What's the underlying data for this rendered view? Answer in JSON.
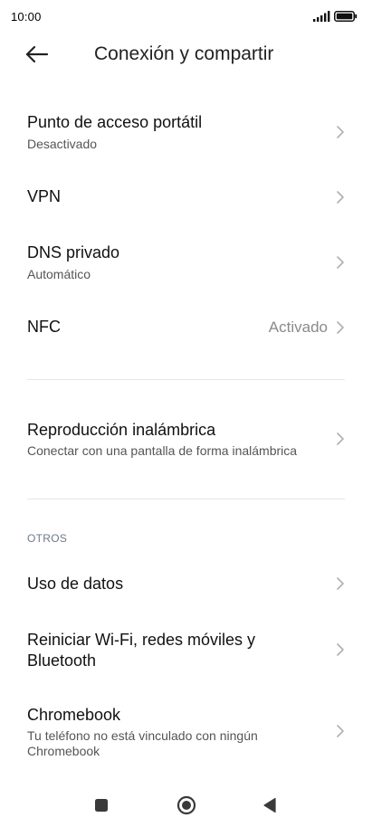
{
  "status_bar": {
    "time": "10:00",
    "signal_icon": "signal-bars-icon",
    "battery_icon": "battery-icon"
  },
  "app_bar": {
    "back_icon": "arrow-left-icon",
    "title": "Conexión y compartir"
  },
  "items": [
    {
      "title": "Punto de acceso portátil",
      "subtitle": "Desactivado",
      "value": ""
    },
    {
      "title": "VPN",
      "subtitle": "",
      "value": ""
    },
    {
      "title": "DNS privado",
      "subtitle": "Automático",
      "value": ""
    },
    {
      "title": "NFC",
      "subtitle": "",
      "value": "Activado"
    },
    {
      "title": "Reproducción inalámbrica",
      "subtitle": "Conectar con una pantalla de forma inalámbrica",
      "value": ""
    }
  ],
  "others": {
    "header": "OTROS",
    "items": [
      {
        "title": "Uso de datos",
        "subtitle": ""
      },
      {
        "title_line1": "Reiniciar Wi-Fi, redes móviles y",
        "title_line2": "Bluetooth",
        "subtitle": ""
      },
      {
        "title": "Chromebook",
        "subtitle_line1": "Tu teléfono no está vinculado con ningún",
        "subtitle_line2": "Chromebook"
      }
    ]
  },
  "nav_bar": {
    "recents_icon": "square-icon",
    "home_icon": "circle-icon",
    "back_icon": "triangle-back-icon"
  },
  "colors": {
    "background": "#ffffff",
    "text_primary": "#111111",
    "text_secondary": "#555555",
    "value_text": "#8a8a8a",
    "section_header": "#6e7a8a",
    "chevron": "#b0b0b0"
  }
}
